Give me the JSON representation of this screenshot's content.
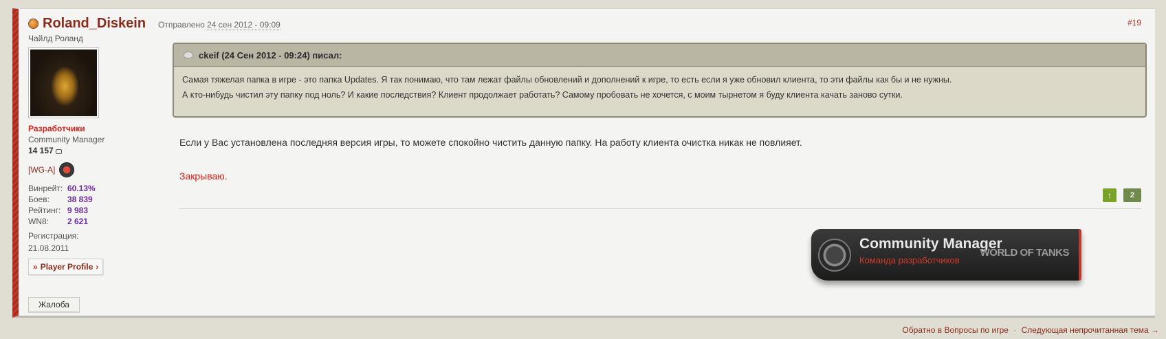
{
  "author": {
    "name": "Roland_Diskein",
    "subtitle": "Чайлд Роланд",
    "group": "Разработчики",
    "role": "Community Manager",
    "posts": "14 157",
    "clan": "[WG-A]",
    "stats": [
      {
        "label": "Винрейт:",
        "value": "60.13%"
      },
      {
        "label": "Боев:",
        "value": "38 839"
      },
      {
        "label": "Рейтинг:",
        "value": "9 983"
      },
      {
        "label": "WN8:",
        "value": "2 621"
      }
    ],
    "registration_label": "Регистрация:",
    "registration_date": "21.08.2011",
    "profile_button": "Player Profile",
    "report_button": "Жалоба"
  },
  "post": {
    "date_prefix": "Отправлено",
    "date": "24 сен 2012 - 09:09",
    "number": "#19",
    "quote": {
      "header": "ckeif (24 Сен 2012 - 09:24) писал:",
      "line1": "Самая тяжелая папка в игре - это папка Updates. Я так понимаю, что там лежат файлы обновлений и дополнений к игре, то есть если я уже обновил клиента, то эти файлы как бы и не нужны.",
      "line2": "А кто-нибудь чистил эту папку под ноль? И какие последствия? Клиент продолжает работать? Самому пробовать не хочется, с моим тырнетом я буду клиента качать заново сутки."
    },
    "reply": "Если у Вас установлена последняя версия игры, то можете спокойно чистить данную папку. На работу клиента очистка никак не повлияет.",
    "closing": "Закрываю.",
    "reputation": "2"
  },
  "signature": {
    "title": "Community Manager",
    "subtitle": "Команда разработчиков",
    "brand": "WORLD OF TANKS"
  },
  "footer": {
    "back_link": "Обратно в Вопросы по игре",
    "separator": "·",
    "next_link": "Следующая непрочитанная тема →"
  },
  "colors": {
    "accent": "#c1392b",
    "author_name": "#8a2b1c",
    "group": "#d6201a",
    "stat_value": "#6a2ea0",
    "quote_bg": "#ddd9c9",
    "rep_up": "#7aa12a"
  }
}
